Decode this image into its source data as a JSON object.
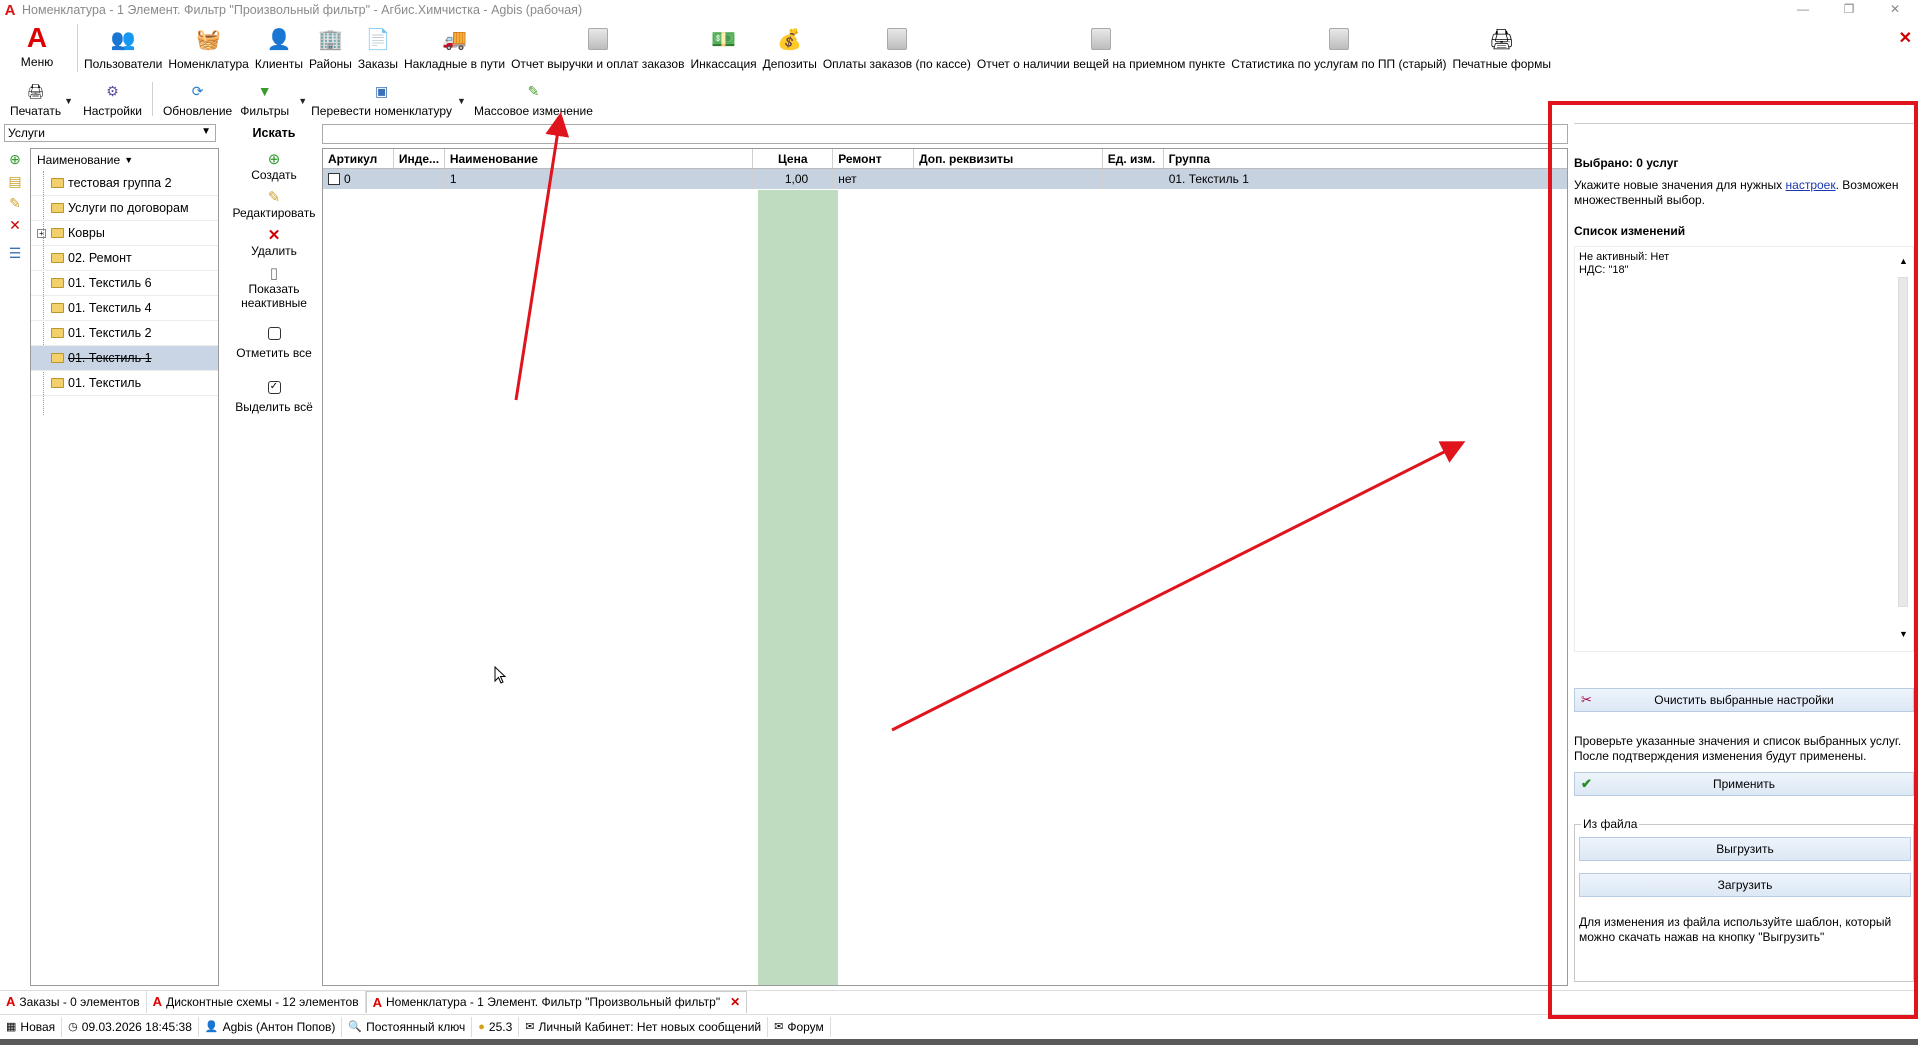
{
  "window": {
    "title": "Номенклатура - 1 Элемент. Фильтр \"Произвольный фильтр\" - Агбис.Химчистка - Agbis (рабочая)",
    "minimize": "—",
    "restore": "❐",
    "close": "✕"
  },
  "ribbon": {
    "menu_label": "Меню",
    "items": [
      {
        "label": "Пользователи",
        "icon": "users-icon"
      },
      {
        "label": "Номенклатура",
        "icon": "basket-icon"
      },
      {
        "label": "Клиенты",
        "icon": "client-icon"
      },
      {
        "label": "Районы",
        "icon": "building-icon"
      },
      {
        "label": "Заказы",
        "icon": "document-icon"
      },
      {
        "label": "Накладные в пути",
        "icon": "truck-icon"
      },
      {
        "label": "Отчет выручки и оплат заказов",
        "icon": "report-icon"
      },
      {
        "label": "Инкассация",
        "icon": "money-icon"
      },
      {
        "label": "Депозиты",
        "icon": "deposit-icon"
      },
      {
        "label": "Оплаты заказов (по кассе)",
        "icon": "report-icon"
      },
      {
        "label": "Отчет о наличии вещей на приемном пункте",
        "icon": "report-icon"
      },
      {
        "label": "Статистика по услугам по ПП (старый)",
        "icon": "report-icon"
      },
      {
        "label": "Печатные формы",
        "icon": "printer-icon"
      }
    ]
  },
  "toolbar": {
    "print": "Печатать",
    "settings": "Настройки",
    "refresh": "Обновление",
    "filters": "Фильтры",
    "translate": "Перевести номенклатуру",
    "mass_change": "Массовое изменение"
  },
  "category_select": {
    "value": "Услуги"
  },
  "tree": {
    "header": "Наименование",
    "items": [
      {
        "label": "тестовая группа 2"
      },
      {
        "label": "Услуги по договорам"
      },
      {
        "label": "Ковры",
        "expandable": true
      },
      {
        "label": "02. Ремонт"
      },
      {
        "label": "01. Текстиль 6"
      },
      {
        "label": "01. Текстиль 4"
      },
      {
        "label": "01. Текстиль 2"
      },
      {
        "label": "01. Текстиль 1",
        "selected": true
      },
      {
        "label": "01. Текстиль"
      }
    ]
  },
  "actions": {
    "search": "Искать",
    "create": "Создать",
    "edit": "Редактировать",
    "delete": "Удалить",
    "show_inactive": "Показать неактивные",
    "check_all": "Отметить все",
    "select_all": "Выделить всё"
  },
  "search": {
    "value": ""
  },
  "grid": {
    "columns": [
      "Артикул",
      "Инде...",
      "Наименование",
      "Цена",
      "Ремонт",
      "Доп. реквизиты",
      "Ед. изм.",
      "Группа"
    ],
    "rows": [
      {
        "article": "0",
        "index": "",
        "name": "1",
        "price": "1,00",
        "repair": "нет",
        "extra": "",
        "unit": "",
        "group": "01. Текстиль 1"
      }
    ]
  },
  "right_panel": {
    "selected": "Выбрано: 0 услуг",
    "hint_before": "Укажите новые значения для нужных ",
    "hint_link": "настроек",
    "hint_after": ". Возможен множественный выбор.",
    "list_title": "Список изменений",
    "changes": [
      "Не активный: Нет",
      "НДС: \"18\""
    ],
    "clear_button": "Очистить выбранные настройки",
    "verify_text": "Проверьте указанные значения и список выбранных услуг. После подтверждения изменения будут применены.",
    "apply_button": "Применить",
    "file_group_title": "Из файла",
    "export_button": "Выгрузить",
    "import_button": "Загрузить",
    "file_note": "Для изменения из файла используйте шаблон, который можно скачать нажав на кнопку \"Выгрузить\""
  },
  "tabs": [
    {
      "label": "Заказы - 0 элементов"
    },
    {
      "label": "Дисконтные схемы - 12 элементов"
    },
    {
      "label": "Номенклатура - 1 Элемент. Фильтр \"Произвольный фильтр\"",
      "active": true
    }
  ],
  "status": {
    "mode": "Новая",
    "datetime": "09.03.2026 18:45:38",
    "user": "Agbis (Антон Попов)",
    "key": "Постоянный ключ",
    "balance": "25.3",
    "cabinet": "Личный Кабинет: Нет новых сообщений",
    "forum": "Форум"
  },
  "annotation_color": "#e0141c"
}
